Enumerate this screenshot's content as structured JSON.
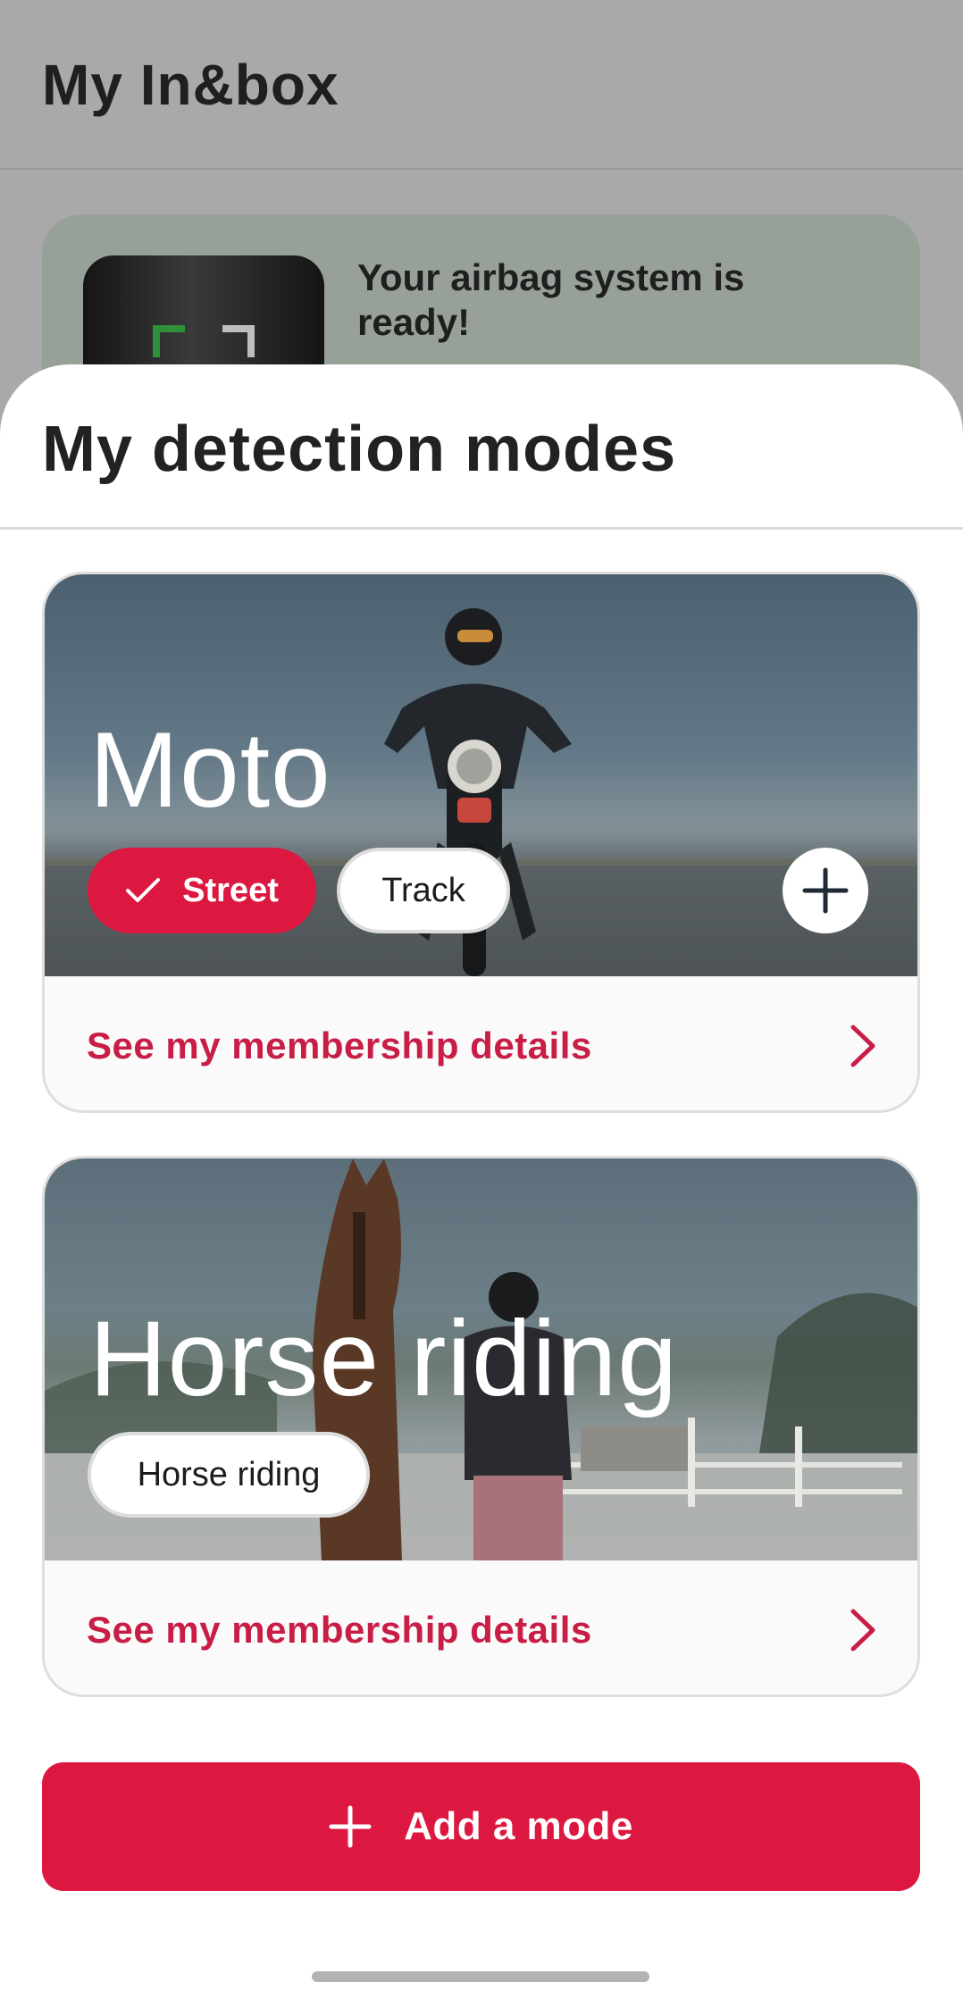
{
  "background_screen": {
    "title": "My In&box",
    "status_card_text": "Your airbag system is ready!"
  },
  "sheet": {
    "title": "My detection modes"
  },
  "modes": [
    {
      "name": "Moto",
      "chips": [
        {
          "label": "Street",
          "selected": true
        },
        {
          "label": "Track",
          "selected": false
        }
      ],
      "add_icon": "plus-circle-icon",
      "footer_label": "See my membership details",
      "footer_icon": "chevron-right-icon"
    },
    {
      "name": "Horse riding",
      "chips": [
        {
          "label": "Horse riding",
          "selected": false
        }
      ],
      "footer_label": "See my membership details",
      "footer_icon": "chevron-right-icon"
    }
  ],
  "add_mode_button": {
    "label": "Add a mode",
    "icon": "plus-icon"
  },
  "colors": {
    "accent": "#dc1840",
    "link": "#c81d45",
    "scrim": "#a9a9a9"
  }
}
